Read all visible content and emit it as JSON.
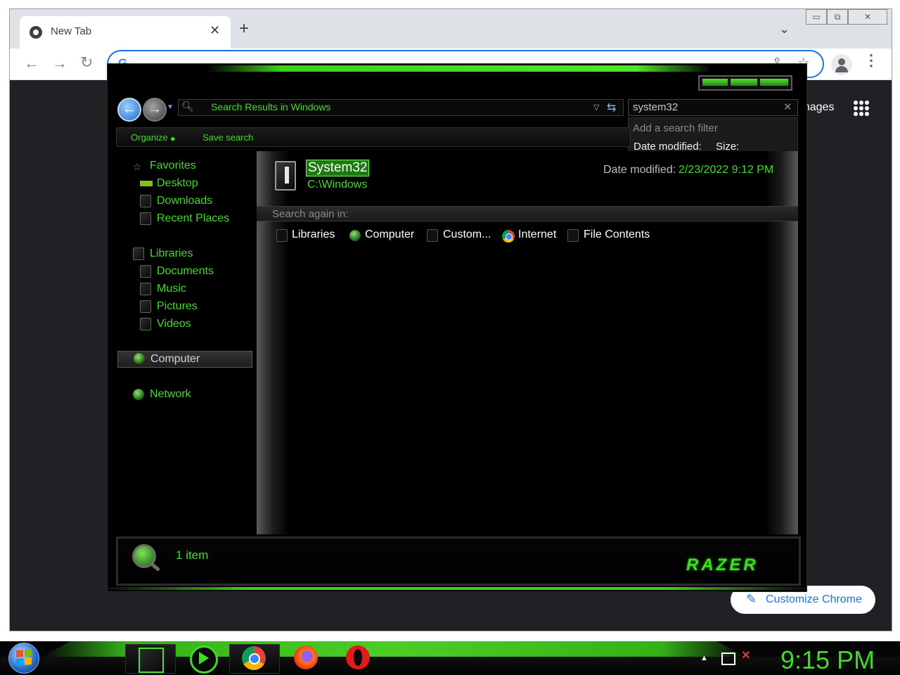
{
  "browser": {
    "tab_title": "New Tab",
    "close_glyph": "✕",
    "new_tab_glyph": "+",
    "tab_dropdown_glyph": "⌄",
    "address_value": "",
    "images_link": "Images",
    "customize_label": "Customize Chrome",
    "colors": {
      "accent": "#1a73e8",
      "page_bg": "#202124"
    }
  },
  "explorer": {
    "address_text": "Search Results in Windows",
    "search_value": "system32",
    "search_dropdown": {
      "hint": "Add a search filter",
      "filter_date": "Date modified:",
      "filter_size": "Size:"
    },
    "commands": {
      "organize": "Organize",
      "save_search": "Save search"
    },
    "nav": {
      "favorites": "Favorites",
      "favorites_items": [
        "Desktop",
        "Downloads",
        "Recent Places"
      ],
      "libraries": "Libraries",
      "libraries_items": [
        "Documents",
        "Music",
        "Pictures",
        "Videos"
      ],
      "computer": "Computer",
      "network": "Network"
    },
    "result": {
      "name": "System32",
      "path": "C:\\Windows",
      "date_label": "Date modified:",
      "date_value": "2/23/2022 9:12 PM"
    },
    "search_again": {
      "label": "Search again in:",
      "items": [
        "Libraries",
        "Computer",
        "Custom...",
        "Internet",
        "File Contents"
      ]
    },
    "status": {
      "count": "1 item",
      "brand": "RAZER"
    },
    "colors": {
      "accent": "#3fdc24",
      "bg": "#000000"
    }
  },
  "taskbar": {
    "clock": "9:15 PM",
    "apps": [
      "explorer-icon",
      "media-player-icon",
      "chrome-icon",
      "firefox-icon",
      "opera-icon"
    ]
  }
}
